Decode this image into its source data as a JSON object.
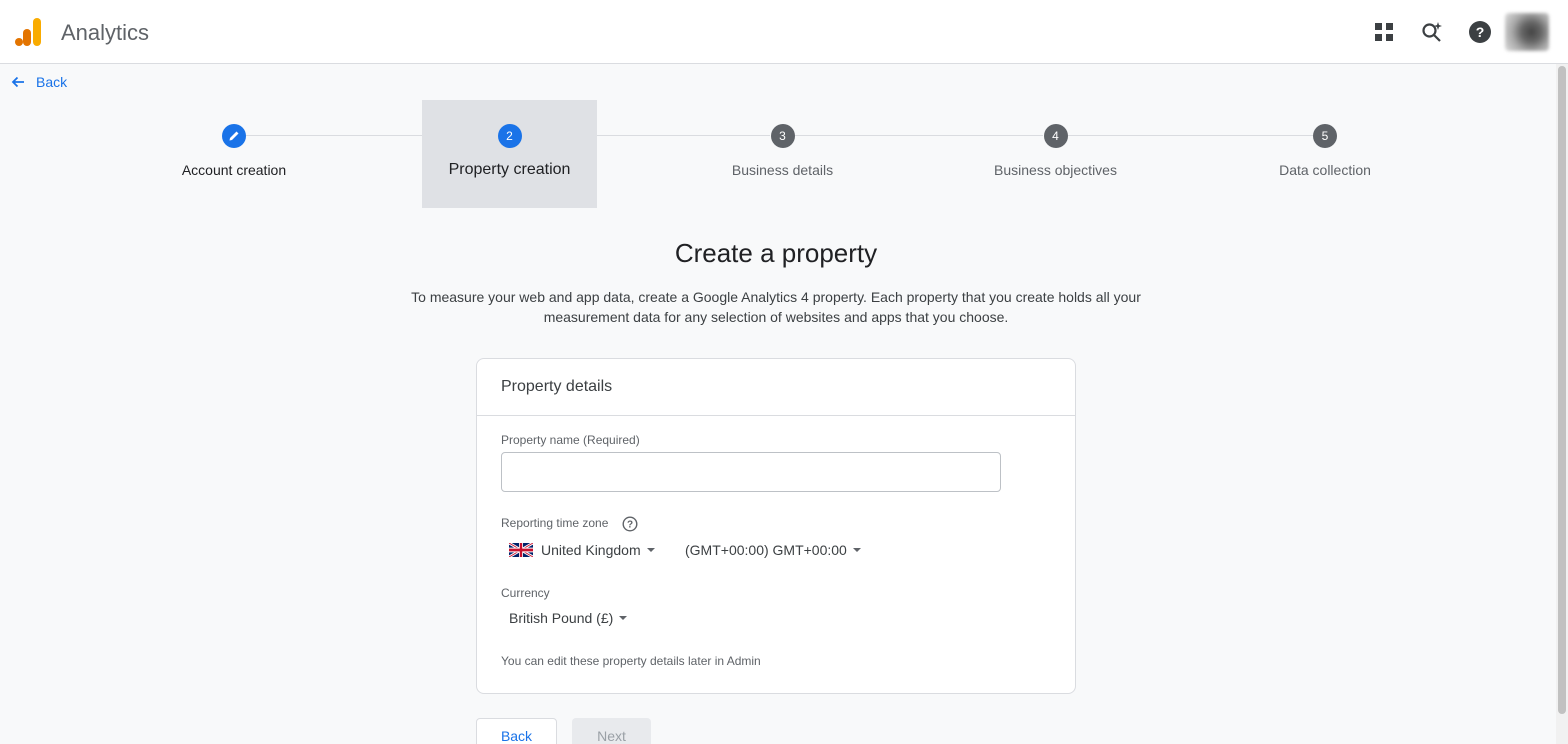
{
  "header": {
    "app_title": "Analytics",
    "icons": [
      "apps-grid-icon",
      "search-spark-icon",
      "help-icon",
      "avatar"
    ]
  },
  "nav": {
    "back_label": "Back"
  },
  "stepper": {
    "steps": [
      {
        "number": "",
        "label": "Account creation",
        "state": "completed"
      },
      {
        "number": "2",
        "label": "Property creation",
        "state": "current"
      },
      {
        "number": "3",
        "label": "Business details",
        "state": "pending"
      },
      {
        "number": "4",
        "label": "Business objectives",
        "state": "pending"
      },
      {
        "number": "5",
        "label": "Data collection",
        "state": "pending"
      }
    ]
  },
  "main": {
    "heading": "Create a property",
    "description": "To measure your web and app data, create a Google Analytics 4 property. Each property that you create holds all your measurement data for any selection of websites and apps that you choose."
  },
  "card": {
    "title": "Property details",
    "property_name_label": "Property name (Required)",
    "property_name_value": "",
    "timezone_label": "Reporting time zone",
    "country_value": "United Kingdom",
    "timezone_value": "(GMT+00:00) GMT+00:00",
    "currency_label": "Currency",
    "currency_value": "British Pound (£)",
    "footnote": "You can edit these property details later in Admin"
  },
  "buttons": {
    "back": "Back",
    "next": "Next"
  },
  "colors": {
    "accent": "#1a73e8",
    "pending_step": "#5f6368",
    "logo_orange": "#f9ab00",
    "logo_dark": "#e37400"
  }
}
